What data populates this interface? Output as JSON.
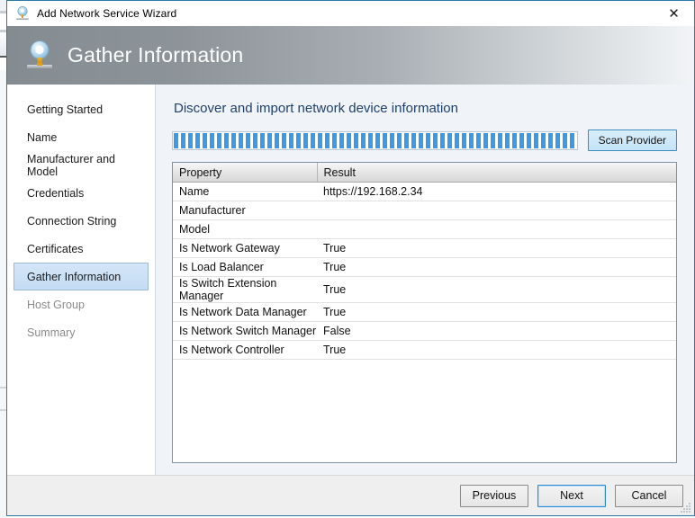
{
  "window": {
    "title": "Add Network Service Wizard",
    "title_icon": "network-service-icon",
    "close_label": "✕"
  },
  "banner": {
    "title": "Gather Information",
    "icon": "network-service-icon"
  },
  "sidebar": {
    "items": [
      {
        "label": "Getting Started",
        "state": "normal"
      },
      {
        "label": "Name",
        "state": "normal"
      },
      {
        "label": "Manufacturer and Model",
        "state": "normal"
      },
      {
        "label": "Credentials",
        "state": "normal"
      },
      {
        "label": "Connection String",
        "state": "normal"
      },
      {
        "label": "Certificates",
        "state": "normal"
      },
      {
        "label": "Gather Information",
        "state": "selected"
      },
      {
        "label": "Host Group",
        "state": "disabled"
      },
      {
        "label": "Summary",
        "state": "disabled"
      }
    ]
  },
  "content": {
    "heading": "Discover and import network device information",
    "progress": {
      "state": "indeterminate",
      "percent": 100,
      "color": "#3b9ae8"
    },
    "scan_button": "Scan Provider",
    "table": {
      "columns": [
        "Property",
        "Result"
      ],
      "rows": [
        {
          "property": "Name",
          "result": "https://192.168.2.34"
        },
        {
          "property": "Manufacturer",
          "result": ""
        },
        {
          "property": "Model",
          "result": ""
        },
        {
          "property": "Is Network Gateway",
          "result": "True"
        },
        {
          "property": "Is Load Balancer",
          "result": "True"
        },
        {
          "property": "Is Switch Extension Manager",
          "result": "True"
        },
        {
          "property": "Is Network Data Manager",
          "result": "True"
        },
        {
          "property": "Is Network Switch Manager",
          "result": "False"
        },
        {
          "property": "Is Network Controller",
          "result": "True"
        }
      ]
    }
  },
  "footer": {
    "previous_label": "Previous",
    "next_label": "Next",
    "cancel_label": "Cancel"
  },
  "colors": {
    "accent": "#3b9ae8",
    "heading": "#1f3f6b",
    "selection": "#c3dcf3",
    "content_bg": "#f0f4f8",
    "footer_bg": "#efefef",
    "window_border": "#2a79a6"
  }
}
